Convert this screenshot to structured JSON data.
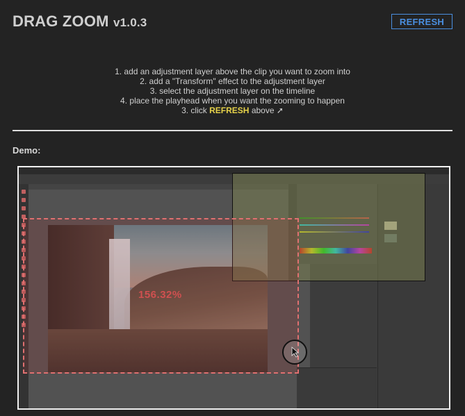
{
  "header": {
    "title": "DRAG ZOOM",
    "version": "v1.0.3",
    "refresh_label": "REFRESH"
  },
  "instructions": {
    "step1": "1. add an adjustment layer above the clip you want to zoom into",
    "step2": "2. add a \"Transform\" effect to the adjustment layer",
    "step3": "3. select the adjustment layer on the timeline",
    "step4": "4. place the playhead when you want the zooming to happen",
    "step5_prefix": "3. click",
    "step5_highlight": "REFRESH",
    "step5_suffix": "above ➚"
  },
  "demo": {
    "label": "Demo:",
    "zoom_percent": "156.32%"
  },
  "colors": {
    "accent_blue": "#4a8fe0",
    "highlight_yellow": "#e6d24a",
    "zoom_red": "#d05050"
  }
}
